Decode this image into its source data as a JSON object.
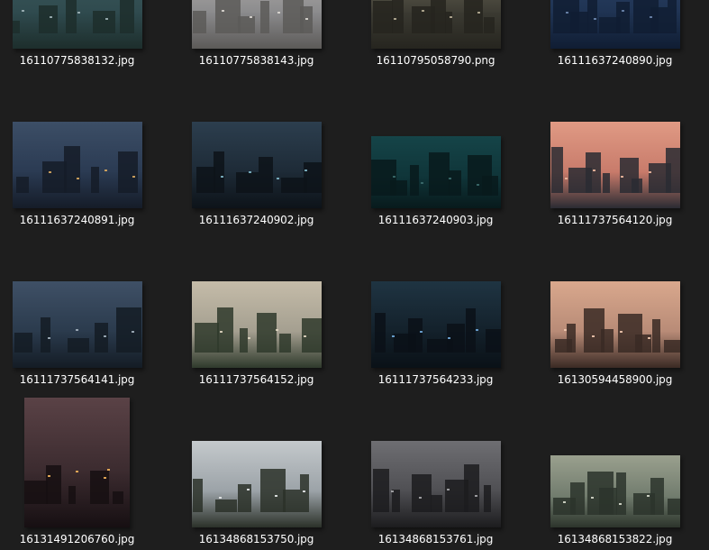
{
  "files": [
    {
      "name": "16110775838132.jpg",
      "palette": [
        "#2f4a4e",
        "#3d5a5c",
        "#1d2e2c",
        "#9fb2b6"
      ]
    },
    {
      "name": "16110775838143.jpg",
      "palette": [
        "#8a8a8c",
        "#b5b1ad",
        "#5c5a58",
        "#dcd8d2"
      ]
    },
    {
      "name": "16110795058790.png",
      "palette": [
        "#3b3a32",
        "#6f6a5a",
        "#26251f",
        "#b6ad95"
      ]
    },
    {
      "name": "16111637240890.jpg",
      "palette": [
        "#1f3352",
        "#2a4266",
        "#101d33",
        "#6d86ad"
      ]
    },
    {
      "name": "16111637240891.jpg",
      "palette": [
        "#2a3a52",
        "#3c4e66",
        "#151c28",
        "#d9a860"
      ]
    },
    {
      "name": "16111637240902.jpg",
      "palette": [
        "#1d2a36",
        "#2c3e4e",
        "#0d1319",
        "#7fb7c9"
      ]
    },
    {
      "name": "16111637240903.jpg",
      "palette": [
        "#0f3438",
        "#154448",
        "#081a1c",
        "#3c6b6b"
      ]
    },
    {
      "name": "16111737564120.jpg",
      "palette": [
        "#c77a6a",
        "#e09a84",
        "#2a2b33",
        "#f0b9a0"
      ]
    },
    {
      "name": "16111737564141.jpg",
      "palette": [
        "#2a3a4c",
        "#3f5066",
        "#141c25",
        "#a3b1be"
      ]
    },
    {
      "name": "16111737564152.jpg",
      "palette": [
        "#a39e8f",
        "#c5bca9",
        "#2f3a2c",
        "#e0d6c1"
      ]
    },
    {
      "name": "16111737564233.jpg",
      "palette": [
        "#13202a",
        "#1f3442",
        "#0a1117",
        "#6fa7d9"
      ]
    },
    {
      "name": "16130594458900.jpg",
      "palette": [
        "#b78a76",
        "#d9a88d",
        "#3a2a24",
        "#f2c9b0"
      ]
    },
    {
      "name": "16131491206760.jpg",
      "palette": [
        "#3a2a2e",
        "#5a4246",
        "#160f12",
        "#f2b25a"
      ]
    },
    {
      "name": "16134868153750.jpg",
      "palette": [
        "#9aa1a6",
        "#c4c9cc",
        "#2b3129",
        "#e8eaeb"
      ]
    },
    {
      "name": "16134868153761.jpg",
      "palette": [
        "#4e4e52",
        "#6e6e72",
        "#1c1c1e",
        "#a8a8ac"
      ]
    },
    {
      "name": "16134868153822.jpg",
      "palette": [
        "#6f7a6c",
        "#9aa08e",
        "#2c342b",
        "#d8dccd"
      ]
    }
  ]
}
